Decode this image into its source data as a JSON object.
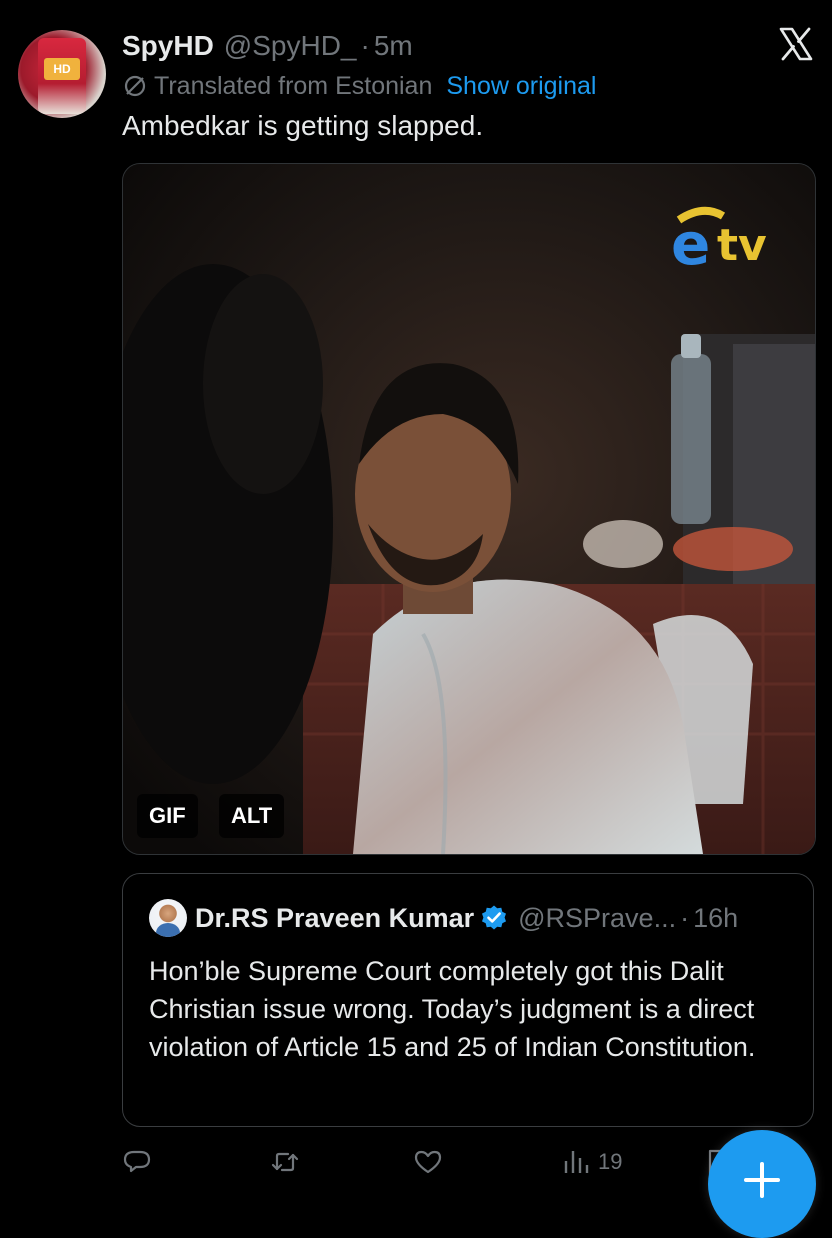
{
  "tweet": {
    "author_name": "SpyHD",
    "author_handle": "@SpyHD_",
    "separator": "·",
    "time": "5m",
    "translation_note": "Translated from Estonian",
    "show_original_label": "Show original",
    "text": "Ambedkar is getting slapped.",
    "avatar_label": "HD"
  },
  "media": {
    "badges": [
      "GIF",
      "ALT"
    ],
    "overlay_logo": "etv-logo"
  },
  "quote": {
    "author_name": "Dr.RS Praveen Kumar",
    "author_handle": "@RSPrave...",
    "separator": "·",
    "time": "16h",
    "verified": true,
    "text": "Hon’ble Supreme Court completely got this Dalit Christian issue wrong. Today’s judgment is a direct violation of Article 15 and 25 of Indian Constitution."
  },
  "actions": {
    "reply_icon": "reply-icon",
    "repost_icon": "repost-icon",
    "like_icon": "like-icon",
    "views_icon": "views-icon",
    "views_count": "19",
    "bookmark_icon": "bookmark-icon"
  },
  "fab": {
    "label": "+"
  },
  "colors": {
    "background": "#000000",
    "text": "#e7e9ea",
    "muted": "#71767b",
    "accent": "#1d9bf0"
  }
}
